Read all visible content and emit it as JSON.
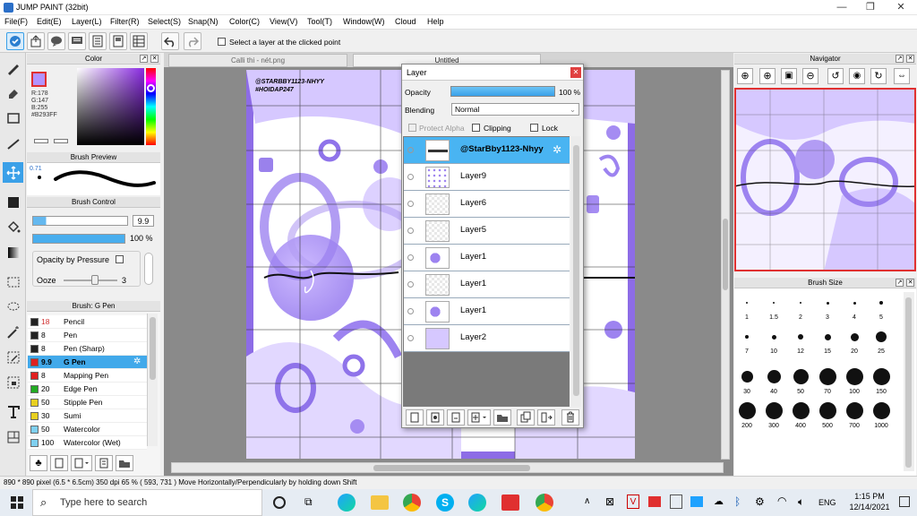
{
  "app": {
    "title": "JUMP PAINT (32bit)"
  },
  "menu": [
    "File(F)",
    "Edit(E)",
    "Layer(L)",
    "Filter(R)",
    "Select(S)",
    "Snap(N)",
    "Color(C)",
    "View(V)",
    "Tool(T)",
    "Window(W)",
    "Cloud",
    "Help"
  ],
  "toolbar": {
    "select_layer_label": "Select a layer at the clicked point"
  },
  "tabs": [
    "Calli thi - nét.png",
    "Untitled"
  ],
  "canvas": {
    "watermark_line1": "@STARBBY1123-NHYY",
    "watermark_line2": "#HOIDAP247"
  },
  "color_panel": {
    "title": "Color",
    "r": "R:178",
    "g": "G:147",
    "b": "B:255",
    "hex": "#B293FF",
    "current": "#b293ff"
  },
  "brush_preview": {
    "title": "Brush Preview",
    "size": "0.71"
  },
  "brush_control": {
    "title": "Brush Control",
    "size": "9.9",
    "density": "100 %",
    "opacity_by_pressure": "Opacity by Pressure",
    "ooze_label": "Ooze",
    "ooze_value": "3"
  },
  "brush_list": {
    "title": "Brush: G Pen",
    "items": [
      {
        "size": "18",
        "name": "Pencil",
        "color": "#222222"
      },
      {
        "size": "8",
        "name": "Pen",
        "color": "#222222"
      },
      {
        "size": "8",
        "name": "Pen (Sharp)",
        "color": "#222222"
      },
      {
        "size": "9.9",
        "name": "G Pen",
        "color": "#e02020"
      },
      {
        "size": "8",
        "name": "Mapping Pen",
        "color": "#e02020"
      },
      {
        "size": "20",
        "name": "Edge Pen",
        "color": "#22aa22"
      },
      {
        "size": "50",
        "name": "Stipple Pen",
        "color": "#e8d020"
      },
      {
        "size": "30",
        "name": "Sumi",
        "color": "#e8d020"
      },
      {
        "size": "50",
        "name": "Watercolor",
        "color": "#7fd0f0"
      },
      {
        "size": "100",
        "name": "Watercolor (Wet)",
        "color": "#7fd0f0"
      }
    ]
  },
  "layer_panel": {
    "title": "Layer",
    "opacity_label": "Opacity",
    "opacity_value": "100 %",
    "blending_label": "Blending",
    "blending_value": "Normal",
    "protect_alpha": "Protect Alpha",
    "clipping": "Clipping",
    "lock": "Lock",
    "layers": [
      "@StarBby1123-Nhyy",
      "Layer9",
      "Layer6",
      "Layer5",
      "Layer1",
      "Layer1",
      "Layer1",
      "Layer2"
    ]
  },
  "navigator": {
    "title": "Navigator"
  },
  "brush_size": {
    "title": "Brush Size",
    "sizes": [
      "1",
      "1.5",
      "2",
      "3",
      "4",
      "5",
      "7",
      "10",
      "12",
      "15",
      "20",
      "25",
      "30",
      "40",
      "50",
      "70",
      "100",
      "150",
      "200",
      "300",
      "400",
      "500",
      "700",
      "1000"
    ]
  },
  "status": {
    "text": "890 * 890 pixel  (6.5 * 6.5cm)  350 dpi  65 %  ( 593, 731 )  Move Horizontally/Perpendicularly by holding down Shift"
  },
  "taskbar": {
    "search_placeholder": "Type here to search",
    "lang": "ENG",
    "time": "1:15 PM",
    "date": "12/14/2021"
  }
}
